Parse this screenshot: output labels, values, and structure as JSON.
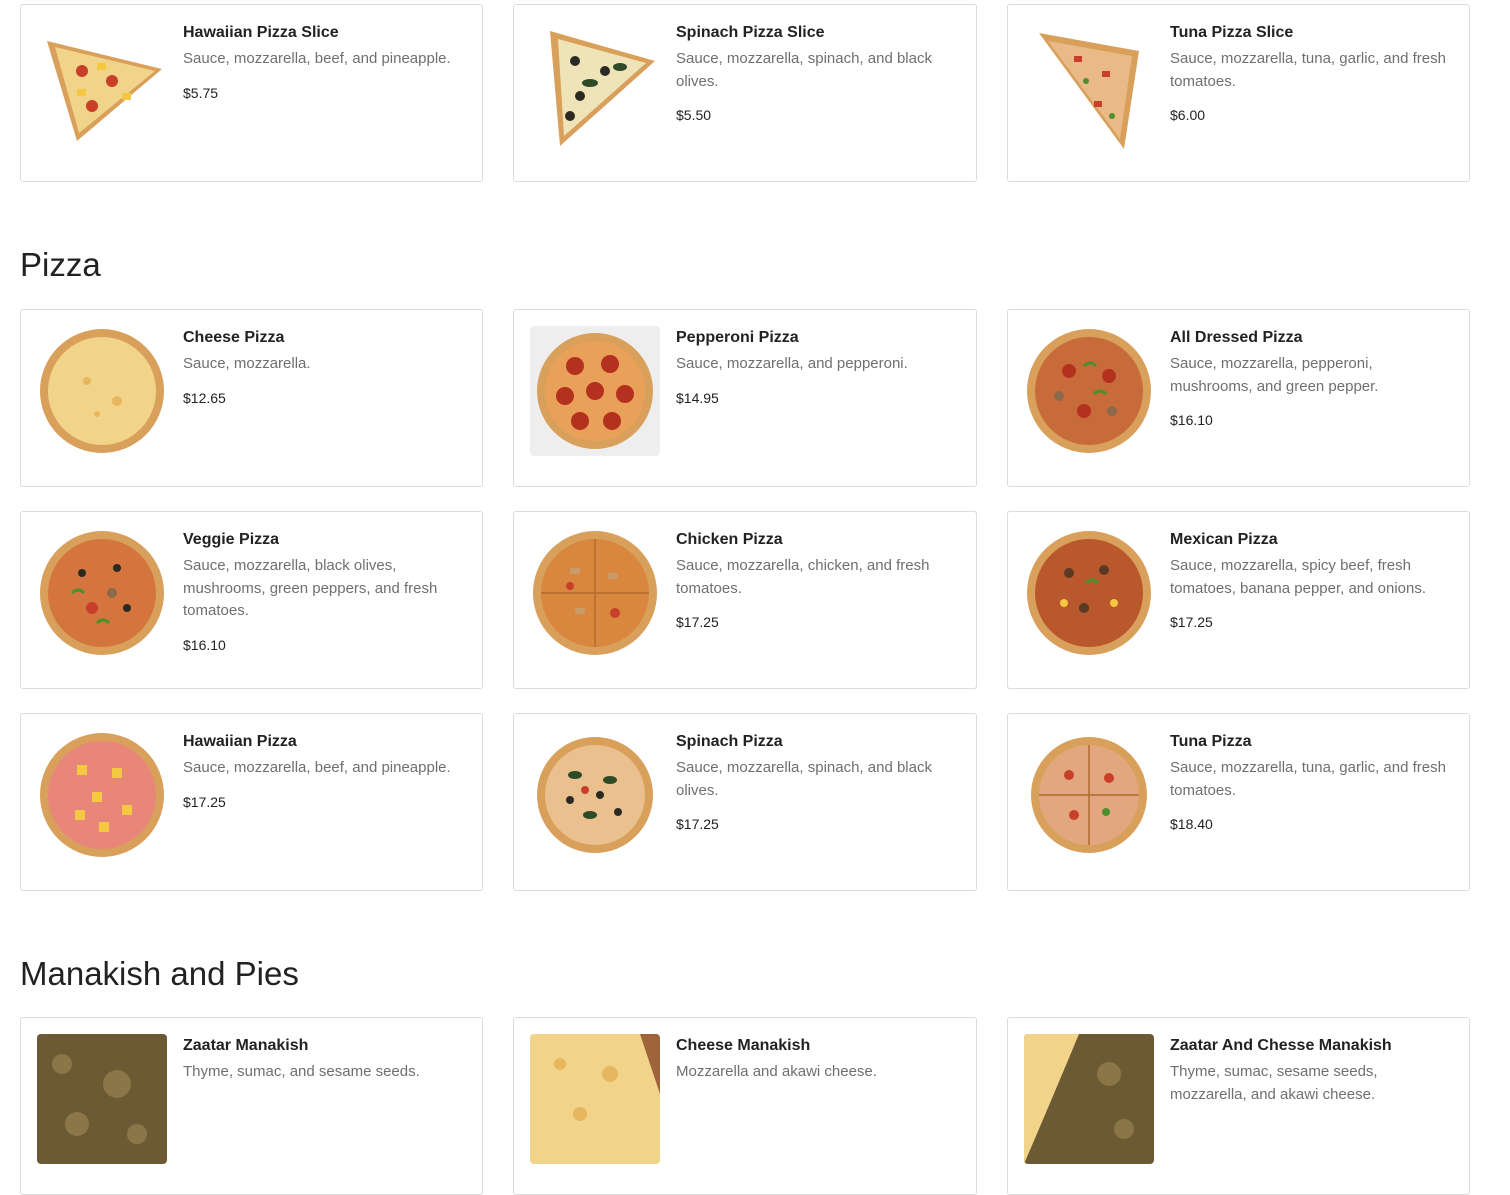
{
  "sections": [
    {
      "title": "",
      "items": [
        {
          "name": "Hawaiian Pizza Slice",
          "desc": "Sauce, mozzarella, beef, and pineapple.",
          "price": "$5.75",
          "icon": "hawaiian-slice-image"
        },
        {
          "name": "Spinach Pizza Slice",
          "desc": "Sauce, mozzarella, spinach, and black olives.",
          "price": "$5.50",
          "icon": "spinach-slice-image"
        },
        {
          "name": "Tuna Pizza Slice",
          "desc": "Sauce, mozzarella, tuna, garlic, and fresh tomatoes.",
          "price": "$6.00",
          "icon": "tuna-slice-image"
        }
      ]
    },
    {
      "title": "Pizza",
      "items": [
        {
          "name": "Cheese Pizza",
          "desc": "Sauce, mozzarella.",
          "price": "$12.65",
          "icon": "cheese-pizza-image"
        },
        {
          "name": "Pepperoni Pizza",
          "desc": "Sauce, mozzarella, and pepperoni.",
          "price": "$14.95",
          "icon": "pepperoni-pizza-image"
        },
        {
          "name": "All Dressed Pizza",
          "desc": "Sauce, mozzarella, pepperoni, mushrooms, and green pepper.",
          "price": "$16.10",
          "icon": "all-dressed-pizza-image"
        },
        {
          "name": "Veggie Pizza",
          "desc": "Sauce, mozzarella, black olives, mushrooms, green peppers, and fresh tomatoes.",
          "price": "$16.10",
          "icon": "veggie-pizza-image"
        },
        {
          "name": "Chicken Pizza",
          "desc": "Sauce, mozzarella, chicken, and fresh tomatoes.",
          "price": "$17.25",
          "icon": "chicken-pizza-image"
        },
        {
          "name": "Mexican Pizza",
          "desc": "Sauce, mozzarella, spicy beef, fresh tomatoes, banana pepper, and onions.",
          "price": "$17.25",
          "icon": "mexican-pizza-image"
        },
        {
          "name": "Hawaiian Pizza",
          "desc": "Sauce, mozzarella, beef, and pineapple.",
          "price": "$17.25",
          "icon": "hawaiian-pizza-image"
        },
        {
          "name": "Spinach Pizza",
          "desc": "Sauce, mozzarella, spinach, and black olives.",
          "price": "$17.25",
          "icon": "spinach-pizza-image"
        },
        {
          "name": "Tuna Pizza",
          "desc": "Sauce, mozzarella, tuna, garlic, and fresh tomatoes.",
          "price": "$18.40",
          "icon": "tuna-pizza-image"
        }
      ]
    },
    {
      "title": "Manakish and Pies",
      "items": [
        {
          "name": "Zaatar Manakish",
          "desc": "Thyme, sumac, and sesame seeds.",
          "price": "",
          "icon": "zaatar-manakish-image"
        },
        {
          "name": "Cheese Manakish",
          "desc": "Mozzarella and akawi cheese.",
          "price": "",
          "icon": "cheese-manakish-image"
        },
        {
          "name": "Zaatar And Chesse Manakish",
          "desc": "Thyme, sumac, sesame seeds, mozzarella, and akawi cheese.",
          "price": "",
          "icon": "zaatar-cheese-manakish-image"
        }
      ]
    }
  ],
  "colors": {
    "crust": "#d9a05b",
    "cheese": "#f2d38a",
    "sauce": "#c8402a",
    "pepperoni": "#b5311f",
    "olive": "#2a2a22",
    "spinach": "#2f4a26",
    "green_pepper": "#4d8f2c",
    "pineapple": "#f5c842",
    "zaatar": "#6b5a33"
  }
}
